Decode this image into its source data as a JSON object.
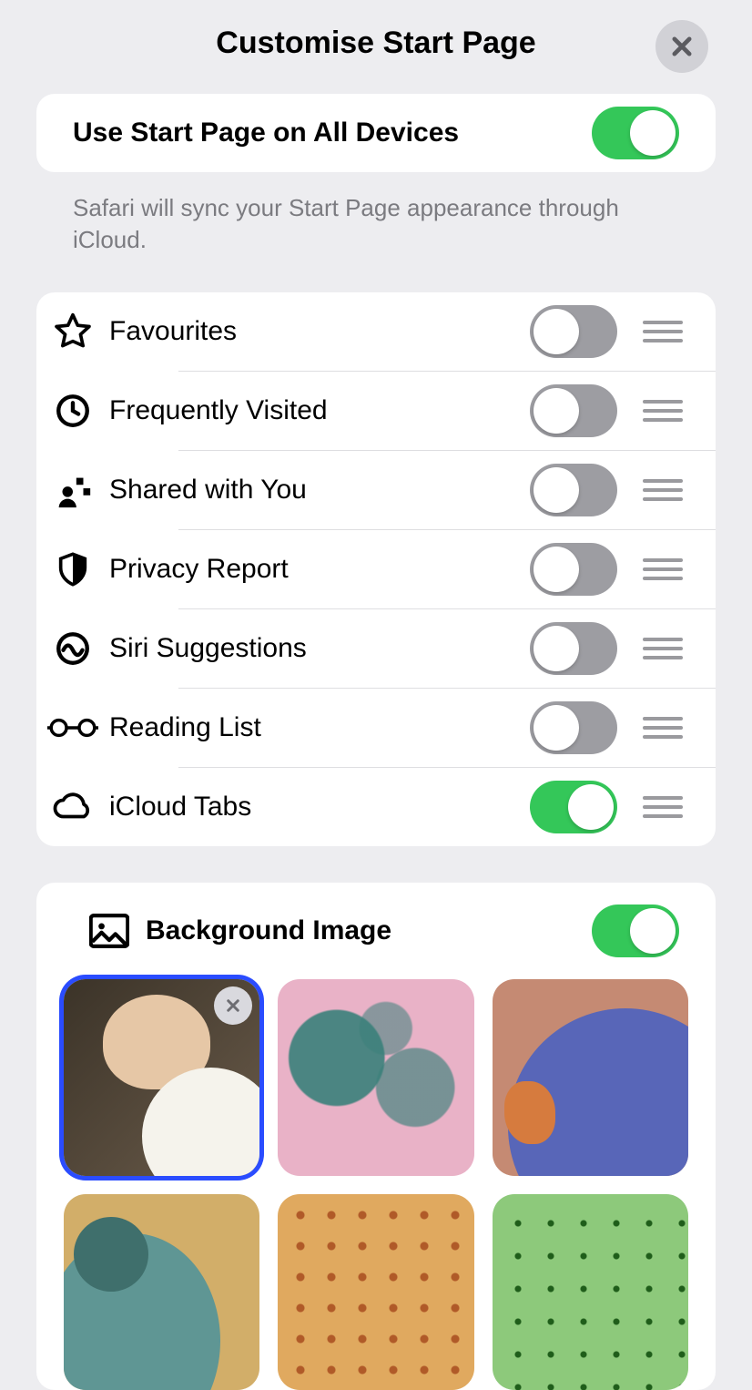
{
  "title": "Customise Start Page",
  "useAll": {
    "label": "Use Start Page on All Devices",
    "on": true
  },
  "helper": "Safari will sync your Start Page appearance through iCloud.",
  "sections": [
    {
      "id": "favourites",
      "label": "Favourites",
      "on": false
    },
    {
      "id": "frequent",
      "label": "Frequently Visited",
      "on": false
    },
    {
      "id": "shared",
      "label": "Shared with You",
      "on": false
    },
    {
      "id": "privacy",
      "label": "Privacy Report",
      "on": false
    },
    {
      "id": "siri",
      "label": "Siri Suggestions",
      "on": false
    },
    {
      "id": "reading",
      "label": "Reading List",
      "on": false
    },
    {
      "id": "icloud",
      "label": "iCloud Tabs",
      "on": true
    }
  ],
  "background": {
    "label": "Background Image",
    "on": true,
    "thumbs": [
      {
        "id": "photo",
        "kind": "user-photo",
        "selected": true
      },
      {
        "id": "butterfly",
        "kind": "butterfly",
        "selected": false
      },
      {
        "id": "bear",
        "kind": "bear",
        "selected": false
      },
      {
        "id": "dodo",
        "kind": "dodo",
        "selected": false
      },
      {
        "id": "dots",
        "kind": "dots",
        "selected": false
      },
      {
        "id": "green",
        "kind": "green",
        "selected": false
      }
    ]
  }
}
